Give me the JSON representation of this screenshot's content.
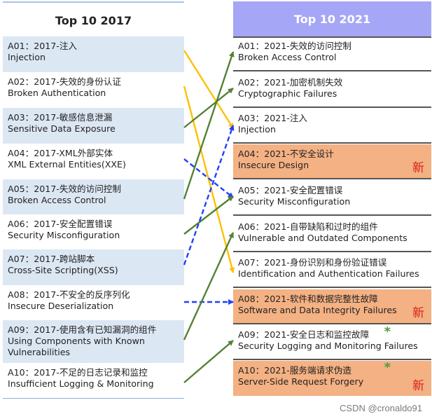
{
  "left": {
    "title": "Top 10 2017",
    "items": [
      {
        "id": "A01",
        "cn": "A01：2017-注入",
        "en": "Injection"
      },
      {
        "id": "A02",
        "cn": "A02：2017-失效的身份认证",
        "en": "Broken Authentication"
      },
      {
        "id": "A03",
        "cn": "A03：2017-敏感信息泄漏",
        "en": "Sensitive Data Exposure"
      },
      {
        "id": "A04",
        "cn": "A04：2017-XML外部实体",
        "en": "XML External Entities(XXE)"
      },
      {
        "id": "A05",
        "cn": "A05：2017-失效的访问控制",
        "en": "Broken Access Control"
      },
      {
        "id": "A06",
        "cn": "A06：2017-安全配置错误",
        "en": "Security Misconfiguration"
      },
      {
        "id": "A07",
        "cn": "A07：2017-跨站脚本",
        "en": "Cross-Site Scripting(XSS)"
      },
      {
        "id": "A08",
        "cn": "A08：2017-不安全的反序列化",
        "en": "Insecure Deserialization"
      },
      {
        "id": "A09",
        "cn": "A09：2017-使用含有已知漏洞的组件",
        "en": "Using Components with Known Vulnerabilities"
      },
      {
        "id": "A10",
        "cn": "A10：2017-不足的日志记录和监控",
        "en": "Insufficient Logging & Monitoring"
      }
    ]
  },
  "right": {
    "title": "Top 10 2021",
    "new_label": "新",
    "star_label": "*",
    "items": [
      {
        "id": "A01",
        "cn": "A01：2021-失效的访问控制",
        "en": "Broken Access Control",
        "new": false,
        "star": false
      },
      {
        "id": "A02",
        "cn": "A02：2021-加密机制失效",
        "en": "Cryptographic Failures",
        "new": false,
        "star": false
      },
      {
        "id": "A03",
        "cn": "A03：2021-注入",
        "en": "Injection",
        "new": false,
        "star": false
      },
      {
        "id": "A04",
        "cn": "A04：2021-不安全设计",
        "en": "Insecure Design",
        "new": true,
        "star": false
      },
      {
        "id": "A05",
        "cn": "A05：2021-安全配置错误",
        "en": "Security Misconfiguration",
        "new": false,
        "star": false
      },
      {
        "id": "A06",
        "cn": "A06：2021-自带缺陷和过时的组件",
        "en": "Vulnerable and Outdated Components",
        "new": false,
        "star": false
      },
      {
        "id": "A07",
        "cn": "A07：2021-身份识别和身份验证错误",
        "en": "Identification and Authentication Failures",
        "new": false,
        "star": false
      },
      {
        "id": "A08",
        "cn": "A08：2021-软件和数据完整性故障",
        "en": "Software and Data Integrity Failures",
        "new": true,
        "star": false
      },
      {
        "id": "A09",
        "cn": "A09：2021-安全日志和监控故障",
        "en": "Security Logging and Monitoring Failures",
        "new": false,
        "star": true
      },
      {
        "id": "A10",
        "cn": "A10：2021-服务端请求伪造",
        "en": "Server-Side Request Forgery",
        "new": true,
        "star": true
      }
    ]
  },
  "mappings": [
    {
      "from": "A01",
      "to": "A03",
      "style": "yellow"
    },
    {
      "from": "A02",
      "to": "A07",
      "style": "yellow"
    },
    {
      "from": "A03",
      "to": "A02",
      "style": "green"
    },
    {
      "from": "A04",
      "to": "A05",
      "style": "blue-dashed"
    },
    {
      "from": "A05",
      "to": "A01",
      "style": "green"
    },
    {
      "from": "A06",
      "to": "A05",
      "style": "green"
    },
    {
      "from": "A07",
      "to": "A03",
      "style": "blue-dashed"
    },
    {
      "from": "A08",
      "to": "A08",
      "style": "blue-dashed"
    },
    {
      "from": "A09",
      "to": "A06",
      "style": "green"
    },
    {
      "from": "A10",
      "to": "A09",
      "style": "green"
    }
  ],
  "colors": {
    "yellow": "#ffc000",
    "green": "#548235",
    "blue-dashed": "#1f3fff"
  },
  "watermark": "CSDN @cronaldo91"
}
